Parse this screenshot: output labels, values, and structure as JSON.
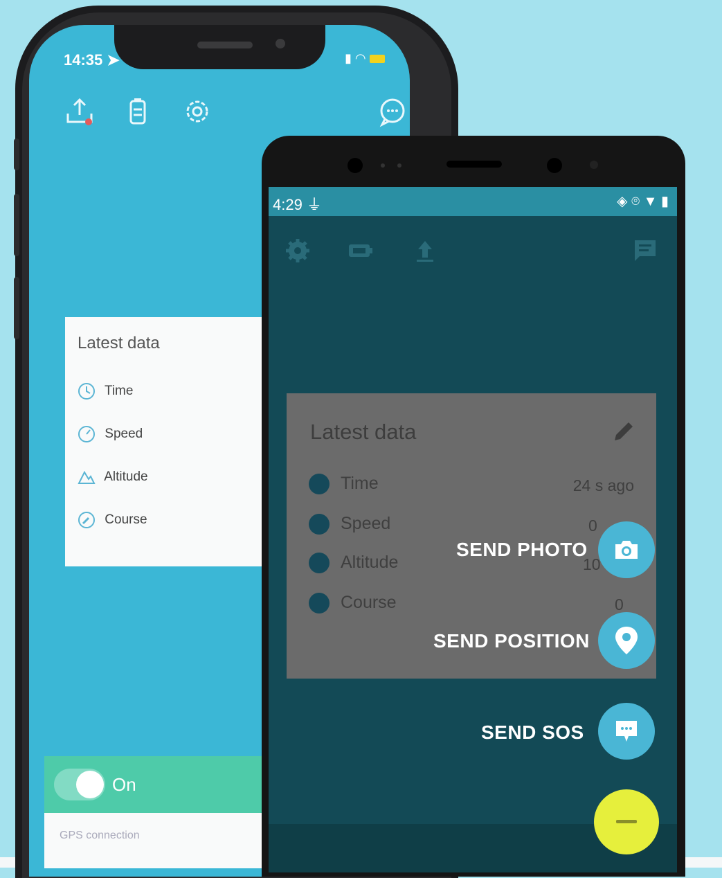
{
  "iphone": {
    "time": "14:35",
    "card": {
      "title": "Latest data",
      "rows": [
        "Time",
        "Speed",
        "Altitude",
        "Course"
      ]
    },
    "toggle_label": "On",
    "gps_label": "GPS connection"
  },
  "android": {
    "time": "4:29",
    "card": {
      "title": "Latest data",
      "rows": [
        {
          "label": "Time",
          "value": "24 s ago"
        },
        {
          "label": "Speed",
          "value": "0"
        },
        {
          "label": "Altitude",
          "value": "10"
        },
        {
          "label": "Course",
          "value": "0"
        }
      ]
    },
    "actions": {
      "photo": "SEND PHOTO",
      "position": "SEND POSITION",
      "sos": "SEND SOS"
    }
  },
  "colors": {
    "background": "#a5e2ee",
    "ios_screen": "#3bb7d6",
    "toggle_green": "#4ecba9",
    "android_screen": "#134a56",
    "fab_blue": "#4ab6d5",
    "fab_yellow": "#e6ef3c"
  }
}
